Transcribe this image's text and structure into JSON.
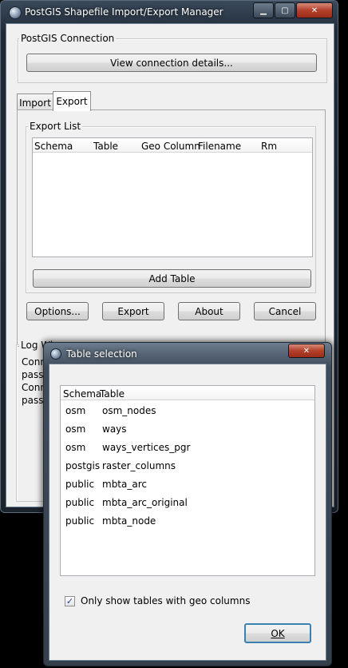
{
  "main": {
    "title": "PostGIS Shapefile Import/Export Manager",
    "connection": {
      "group_label": "PostGIS Connection",
      "view_button": "View connection details..."
    },
    "tabs": [
      {
        "label": "Import",
        "active": false
      },
      {
        "label": "Export",
        "active": true
      }
    ],
    "export_list": {
      "group_label": "Export List",
      "columns": [
        "Schema",
        "Table",
        "Geo Column",
        "Filename",
        "Rm"
      ],
      "add_button": "Add Table"
    },
    "buttons": {
      "options": "Options...",
      "export": "Export",
      "about": "About",
      "cancel": "Cancel"
    },
    "log": {
      "group_label": "Log Wi",
      "lines": [
        "Conn",
        "passv",
        "Conn",
        "passv"
      ]
    }
  },
  "dialog": {
    "title": "Table selection",
    "columns": [
      "Schema",
      "Table"
    ],
    "rows": [
      [
        "osm",
        "osm_nodes"
      ],
      [
        "osm",
        "ways"
      ],
      [
        "osm",
        "ways_vertices_pgr"
      ],
      [
        "postgis",
        "raster_columns"
      ],
      [
        "public",
        "mbta_arc"
      ],
      [
        "public",
        "mbta_arc_original"
      ],
      [
        "public",
        "mbta_node"
      ]
    ],
    "checkbox": {
      "label": "Only show tables with geo columns",
      "checked": true
    },
    "ok_button": "OK",
    "close_glyph": "✕"
  },
  "window_controls": {
    "minimize": "▁",
    "maximize": "▢",
    "close": "✕"
  },
  "colors": {
    "title_bar": "#2a3441",
    "close_button": "#b3402a",
    "client": "#f0f0f0"
  }
}
